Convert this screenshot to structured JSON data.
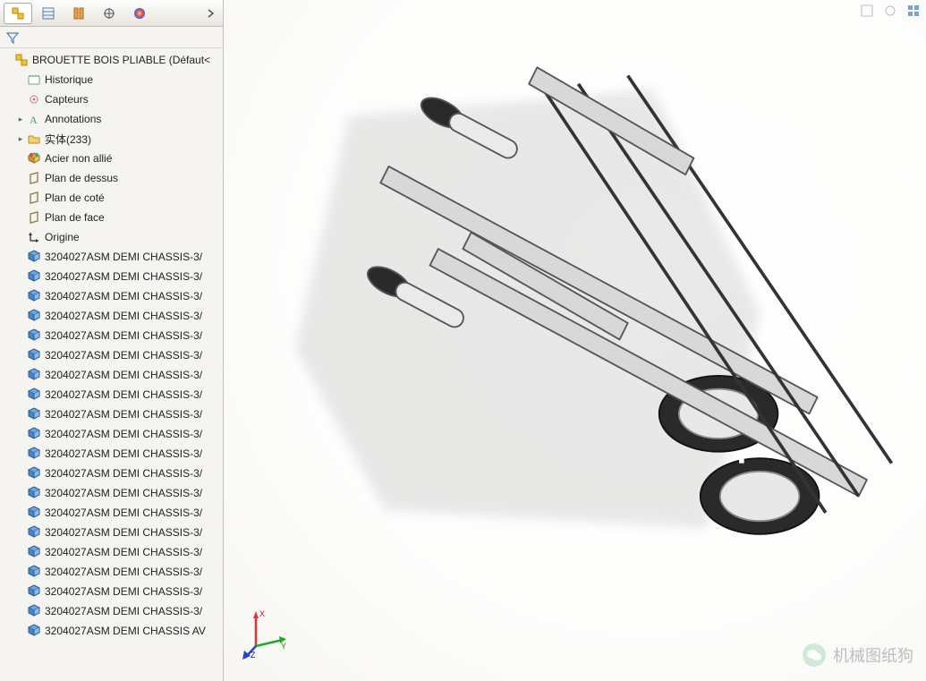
{
  "tabs": [
    {
      "name": "feature-tree-tab",
      "active": true
    },
    {
      "name": "property-tab",
      "active": false
    },
    {
      "name": "config-tab",
      "active": false
    },
    {
      "name": "dimxpert-tab",
      "active": false
    },
    {
      "name": "appearance-tab",
      "active": false
    }
  ],
  "root": {
    "label": "BROUETTE BOIS PLIABLE  (Défaut<",
    "icon": "part"
  },
  "tree": [
    {
      "depth": 1,
      "icon": "history",
      "label": "Historique",
      "expand": ""
    },
    {
      "depth": 1,
      "icon": "sensor",
      "label": "Capteurs",
      "expand": ""
    },
    {
      "depth": 1,
      "icon": "annot",
      "label": "Annotations",
      "expand": "▸"
    },
    {
      "depth": 1,
      "icon": "folder",
      "label": "实体(233)",
      "expand": "▸"
    },
    {
      "depth": 1,
      "icon": "material",
      "label": "Acier non allié",
      "expand": ""
    },
    {
      "depth": 1,
      "icon": "plane",
      "label": "Plan de dessus",
      "expand": ""
    },
    {
      "depth": 1,
      "icon": "plane",
      "label": "Plan de coté",
      "expand": ""
    },
    {
      "depth": 1,
      "icon": "plane",
      "label": "Plan de face",
      "expand": ""
    },
    {
      "depth": 1,
      "icon": "origin",
      "label": "Origine",
      "expand": ""
    },
    {
      "depth": 1,
      "icon": "body",
      "label": "3204027ASM DEMI CHASSIS-3/",
      "expand": ""
    },
    {
      "depth": 1,
      "icon": "body",
      "label": "3204027ASM DEMI CHASSIS-3/",
      "expand": ""
    },
    {
      "depth": 1,
      "icon": "body",
      "label": "3204027ASM DEMI CHASSIS-3/",
      "expand": ""
    },
    {
      "depth": 1,
      "icon": "body",
      "label": "3204027ASM DEMI CHASSIS-3/",
      "expand": ""
    },
    {
      "depth": 1,
      "icon": "body",
      "label": "3204027ASM DEMI CHASSIS-3/",
      "expand": ""
    },
    {
      "depth": 1,
      "icon": "body",
      "label": "3204027ASM DEMI CHASSIS-3/",
      "expand": ""
    },
    {
      "depth": 1,
      "icon": "body",
      "label": "3204027ASM DEMI CHASSIS-3/",
      "expand": ""
    },
    {
      "depth": 1,
      "icon": "body",
      "label": "3204027ASM DEMI CHASSIS-3/",
      "expand": ""
    },
    {
      "depth": 1,
      "icon": "body",
      "label": "3204027ASM DEMI CHASSIS-3/",
      "expand": ""
    },
    {
      "depth": 1,
      "icon": "body",
      "label": "3204027ASM DEMI CHASSIS-3/",
      "expand": ""
    },
    {
      "depth": 1,
      "icon": "body",
      "label": "3204027ASM DEMI CHASSIS-3/",
      "expand": ""
    },
    {
      "depth": 1,
      "icon": "body",
      "label": "3204027ASM DEMI CHASSIS-3/",
      "expand": ""
    },
    {
      "depth": 1,
      "icon": "body",
      "label": "3204027ASM DEMI CHASSIS-3/",
      "expand": ""
    },
    {
      "depth": 1,
      "icon": "body",
      "label": "3204027ASM DEMI CHASSIS-3/",
      "expand": ""
    },
    {
      "depth": 1,
      "icon": "body",
      "label": "3204027ASM DEMI CHASSIS-3/",
      "expand": ""
    },
    {
      "depth": 1,
      "icon": "body",
      "label": "3204027ASM DEMI CHASSIS-3/",
      "expand": ""
    },
    {
      "depth": 1,
      "icon": "body",
      "label": "3204027ASM DEMI CHASSIS-3/",
      "expand": ""
    },
    {
      "depth": 1,
      "icon": "body",
      "label": "3204027ASM DEMI CHASSIS-3/",
      "expand": ""
    },
    {
      "depth": 1,
      "icon": "body",
      "label": "3204027ASM DEMI CHASSIS-3/",
      "expand": ""
    },
    {
      "depth": 1,
      "icon": "body",
      "label": "3204027ASM DEMI CHASSIS AV",
      "expand": ""
    }
  ],
  "triad": {
    "x": "X",
    "y": "Y",
    "z": "Z"
  },
  "watermark": "机械图纸狗"
}
